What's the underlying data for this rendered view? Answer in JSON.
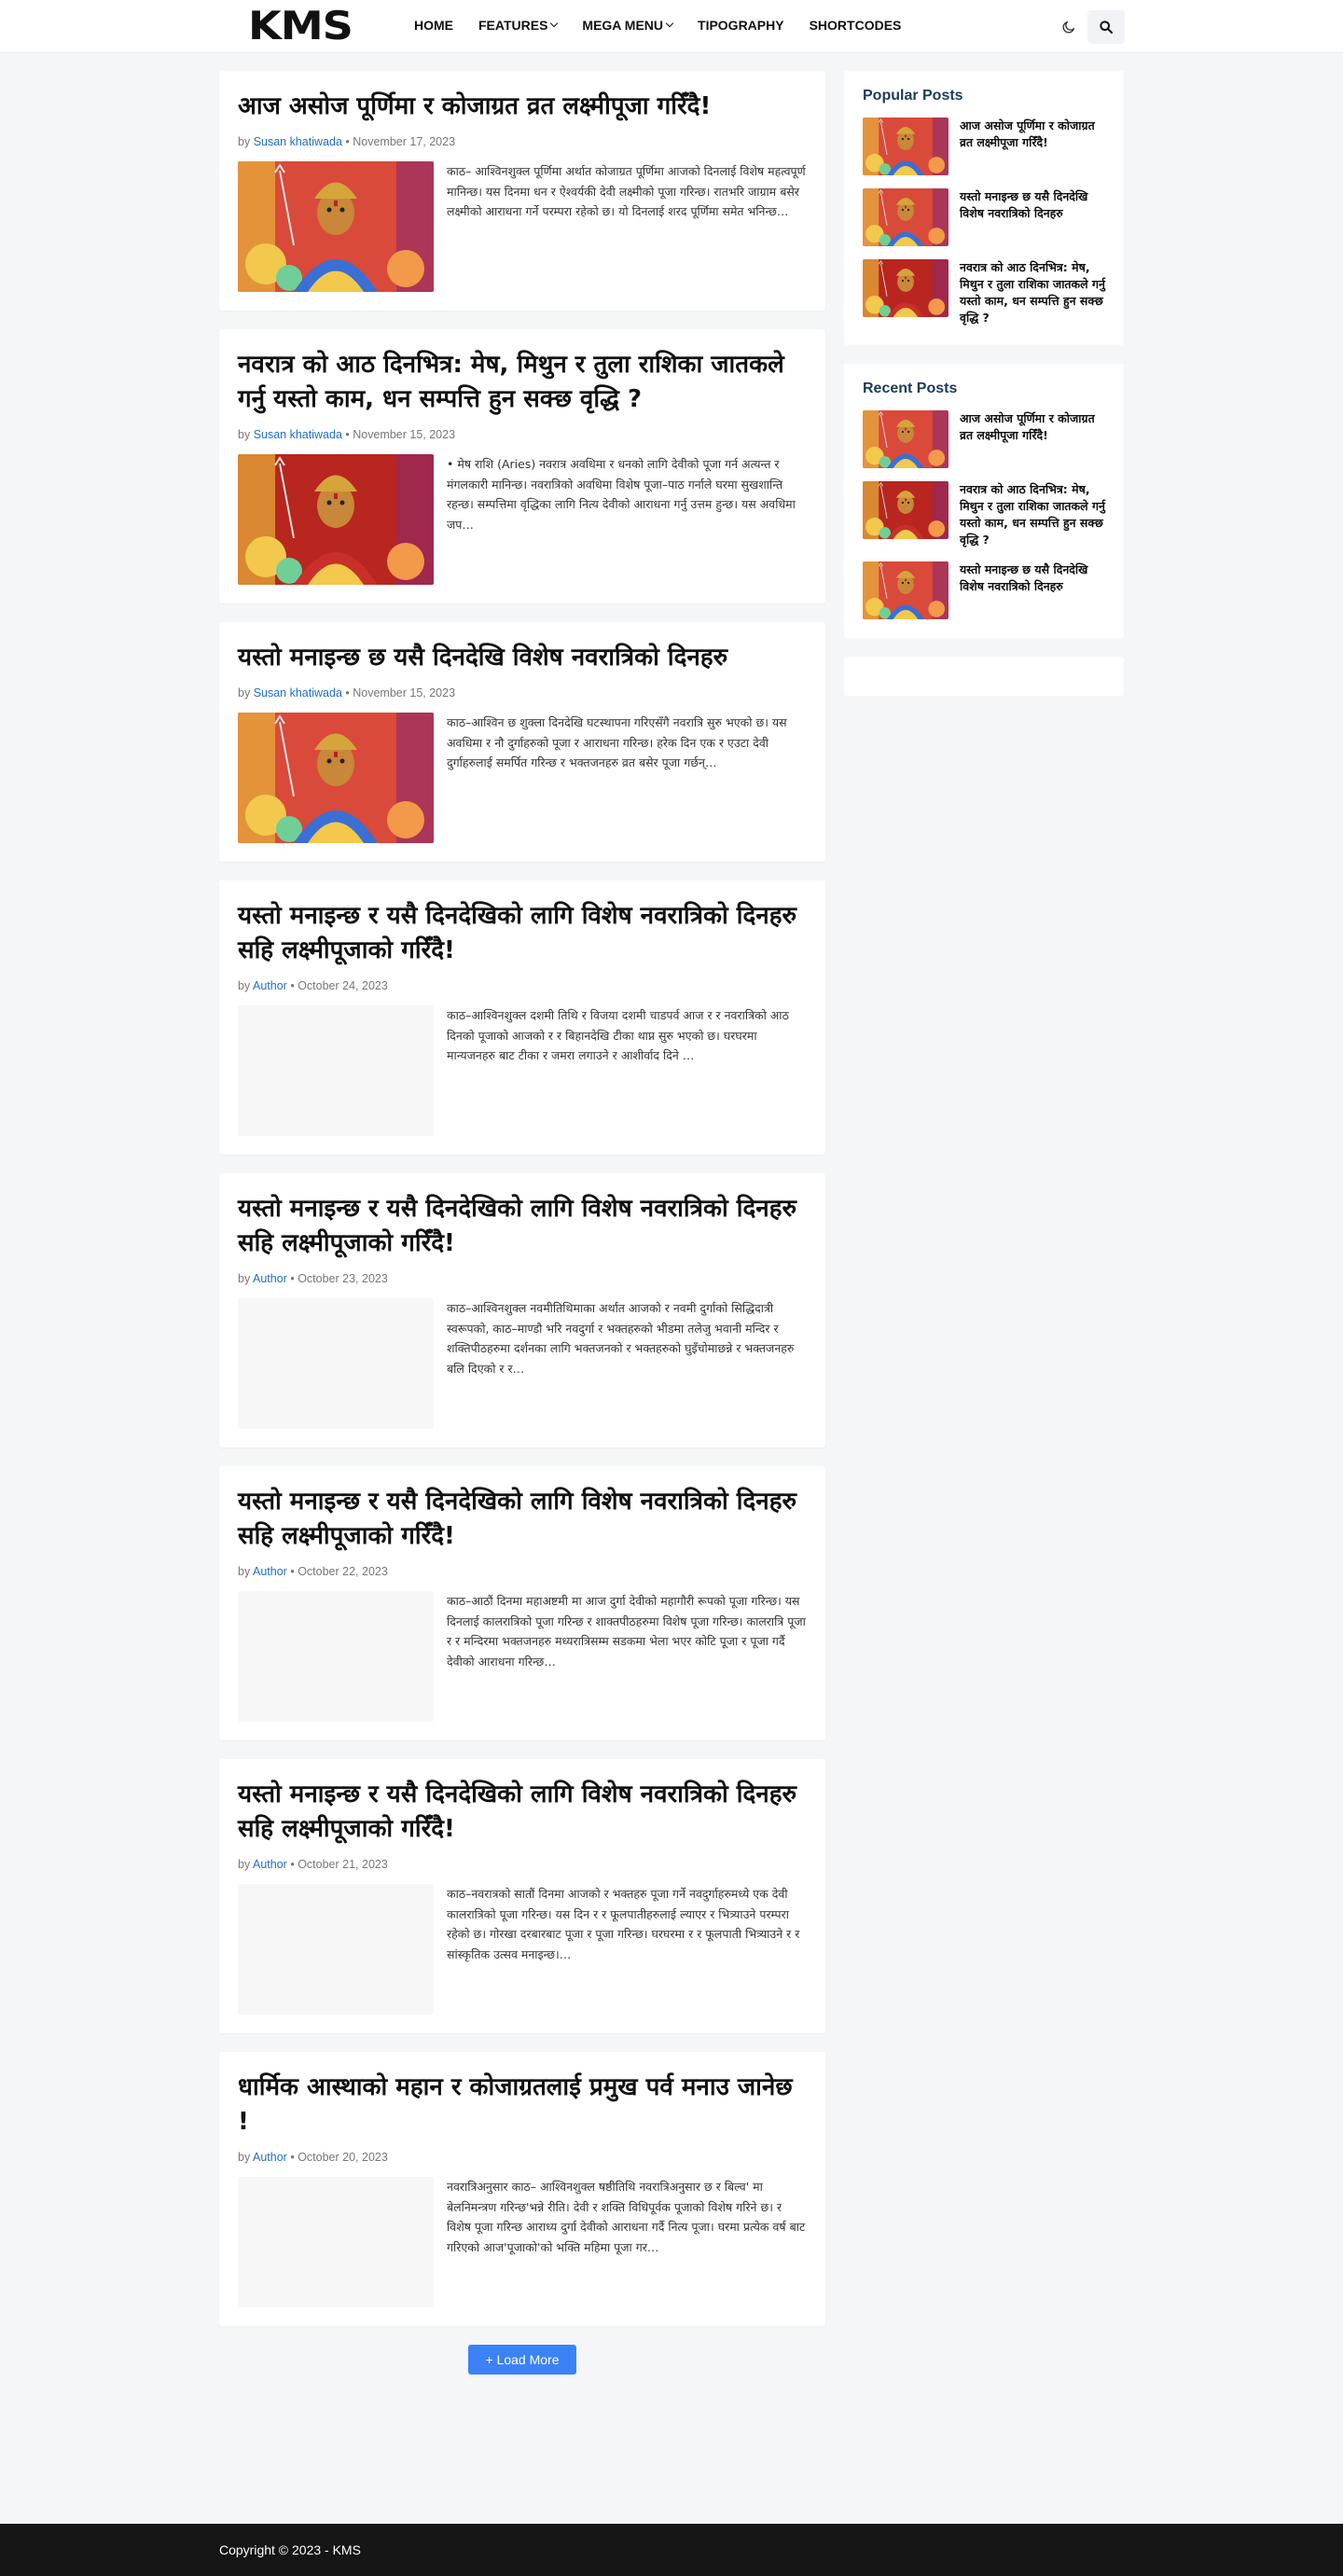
{
  "header": {
    "logo": "KMS",
    "nav": [
      {
        "label": "HOME",
        "dropdown": false
      },
      {
        "label": "FEATURES",
        "dropdown": true
      },
      {
        "label": "MEGA MENU",
        "dropdown": true
      },
      {
        "label": "TIPOGRAPHY",
        "dropdown": false
      },
      {
        "label": "SHORTCODES",
        "dropdown": false
      }
    ],
    "theme_icon": "moon-icon",
    "search_icon": "search-icon"
  },
  "posts": [
    {
      "title": "आज असोज पूर्णिमा र कोजाग्रत व्रत लक्ष्मीपूजा गरिँदै!",
      "by": "by",
      "author": "Susan khatiwada",
      "sep": "•",
      "date": "November 17, 2023",
      "thumb": "goddess-a",
      "excerpt": "काठ– आश्विनशुक्ल पूर्णिमा अर्थात कोजाग्रत पूर्णिमा आजको दिनलाई विशेष महत्वपूर्ण मानिन्छ। यस दिनमा धन र ऐश्वर्यकी देवी लक्ष्मीको पूजा गरिन्छ। रातभरि जाग्राम बसेर लक्ष्मीको आराधना गर्ने परम्परा रहेको छ। यो दिनलाई शरद पूर्णिमा समेत भनिन्छ…"
    },
    {
      "title": "नवरात्र को आठ दिनभित्र: मेष, मिथुन र तुला राशिका जातकले गर्नु यस्तो काम, धन सम्पत्ति हुन सक्छ वृद्धि ?",
      "by": "by",
      "author": "Susan khatiwada",
      "sep": "•",
      "date": "November 15, 2023",
      "thumb": "goddess-b",
      "excerpt": "• मेष राशि (Aries) नवरात्र अवधिमा र धनको लागि देवीको पूजा गर्न अत्यन्त र मंगलकारी मानिन्छ। नवरात्रिको अवधिमा विशेष पूजा–पाठ गर्नाले घरमा सुखशान्ति रहन्छ। सम्पत्तिमा वृद्धिका लागि नित्य देवीको आराधना गर्नु उत्तम हुन्छ। यस अवधिमा जप…"
    },
    {
      "title": "यस्तो मनाइन्छ छ यसै दिनदेखि विशेष नवरात्रिको दिनहरु",
      "by": "by",
      "author": "Susan khatiwada",
      "sep": "•",
      "date": "November 15, 2023",
      "thumb": "goddess-a",
      "excerpt": "काठ–आश्विन छ शुक्ला दिनदेखि घटस्थापना गरिएसँगै नवरात्रि सुरु भएको छ। यस अवधिमा र नौ दुर्गाहरुको पूजा र आराधना गरिन्छ। हरेक दिन एक र एउटा देवी दुर्गाहरुलाई समर्पित गरिन्छ र भक्तजनहरु व्रत बसेर पूजा गर्छन्…"
    },
    {
      "title": "यस्तो मनाइन्छ र यसै दिनदेखिको लागि विशेष नवरात्रिको दिनहरु सहि लक्ष्मीपूजाको गरिँदै!",
      "by": "by",
      "author": "Author",
      "sep": "•",
      "date": "October 24, 2023",
      "thumb": "blank",
      "excerpt": "काठ–आश्विनशुक्ल दशमी तिथि र विजया दशमी चाडपर्व आज र र नवरात्रिको आठ दिनको पूजाको आजको र र बिहानदेखि टीका थाप्न सुरु भएको छ। घरघरमा मान्यजनहरु बाट टीका र जमरा लगाउने र आशीर्वाद दिने …"
    },
    {
      "title": "यस्तो मनाइन्छ र यसै दिनदेखिको लागि विशेष नवरात्रिको दिनहरु सहि लक्ष्मीपूजाको गरिँदै!",
      "by": "by",
      "author": "Author",
      "sep": "•",
      "date": "October 23, 2023",
      "thumb": "blank",
      "excerpt": "काठ–आश्विनशुक्ल नवमीतिथिमाका अर्थात आजको र नवमी दुर्गाको सिद्धिदात्री स्वरूपको, काठ–माण्डौ भरि नवदुर्गा र भक्तहरुको भीडमा तलेजु भवानी मन्दिर र शक्तिपीठहरुमा दर्शनका लागि भक्तजनको र भक्तहरुको घुइँचोमाछन्ने र भक्तजनहरु बलि दिएको र र…"
    },
    {
      "title": "यस्तो मनाइन्छ र यसै दिनदेखिको लागि विशेष नवरात्रिको दिनहरु सहि लक्ष्मीपूजाको गरिँदै!",
      "by": "by",
      "author": "Author",
      "sep": "•",
      "date": "October 22, 2023",
      "thumb": "blank",
      "excerpt": "काठ–आठौं दिनमा महाअष्टमी मा आज दुर्गा देवीको महागौरी रूपको पूजा गरिन्छ। यस दिनलाई कालरात्रिको पूजा गरिन्छ र शाक्तपीठहरुमा विशेष पूजा गरिन्छ। कालरात्रि पूजा र र मन्दिरमा भक्तजनहरु मध्यरात्रिसम्म सडकमा भेला भएर कोटि पूजा र पूजा गर्दै देवीको आराधना गरिन्छ…"
    },
    {
      "title": "यस्तो मनाइन्छ र यसै दिनदेखिको लागि विशेष नवरात्रिको दिनहरु सहि लक्ष्मीपूजाको गरिँदै!",
      "by": "by",
      "author": "Author",
      "sep": "•",
      "date": "October 21, 2023",
      "thumb": "blank",
      "excerpt": "काठ–नवरात्रको सातौं दिनमा आजको र भक्तहरु पूजा गर्ने नवदुर्गाहरुमध्ये एक देवी कालरात्रिको पूजा गरिन्छ। यस दिन र र फूलपातीहरुलाई ल्याएर र भित्र्याउने परम्परा रहेको छ। गोरखा दरबारबाट पूजा र पूजा गरिन्छ। घरघरमा र र फूलपाती भित्र्याउने र र सांस्कृतिक उत्सव मनाइन्छ।…"
    },
    {
      "title": "धार्मिक आस्थाको महान र कोजाग्रतलाई प्रमुख पर्व मनाउ जानेछ !",
      "by": "by",
      "author": "Author",
      "sep": "•",
      "date": "October 20, 2023",
      "thumb": "blank",
      "excerpt": "नवरात्रिअनुसार काठ– आश्विनशुक्ल षष्ठीतिथि नवरात्रिअनुसार छ र बिल्व' मा बेलनिमन्त्रण गरिन्छ'भन्ने रीति। देवी र शक्ति विधिपूर्वक पूजाको विशेष गरिने छ। र विशेष पूजा गरिन्छ आराध्य दुर्गा देवीको आराधना गर्दै नित्य पूजा। घरमा प्रत्येक वर्ष बाट गरिएको आज'पूजाको'को भक्ति महिमा पूजा गर…"
    }
  ],
  "load_more": {
    "icon": "+",
    "label": "Load More"
  },
  "sidebar": {
    "popular": {
      "title": "Popular Posts",
      "items": [
        {
          "thumb": "goddess-a",
          "title": "आज असोज पूर्णिमा र कोजाग्रत व्रत लक्ष्मीपूजा गरिँदै!"
        },
        {
          "thumb": "goddess-a",
          "title": "यस्तो मनाइन्छ छ यसै दिनदेखि विशेष नवरात्रिको दिनहरु"
        },
        {
          "thumb": "goddess-b",
          "title": "नवरात्र को आठ दिनभित्र: मेष, मिथुन र तुला राशिका जातकले गर्नु यस्तो काम, धन सम्पत्ति हुन सक्छ वृद्धि ?"
        }
      ]
    },
    "recent": {
      "title": "Recent Posts",
      "items": [
        {
          "thumb": "goddess-a",
          "title": "आज असोज पूर्णिमा र कोजाग्रत व्रत लक्ष्मीपूजा गरिँदै!"
        },
        {
          "thumb": "goddess-b",
          "title": "नवरात्र को आठ दिनभित्र: मेष, मिथुन र तुला राशिका जातकले गर्नु यस्तो काम, धन सम्पत्ति हुन सक्छ वृद्धि ?"
        },
        {
          "thumb": "goddess-a",
          "title": "यस्तो मनाइन्छ छ यसै दिनदेखि विशेष नवरात्रिको दिनहरु"
        }
      ]
    }
  },
  "footer": {
    "copyright": "Copyright © 2023 - KMS"
  },
  "colors": {
    "accent": "#3b82f6",
    "link": "#1f6fc5",
    "widget_title": "#1e3a5f",
    "footer_bg": "#161616",
    "page_bg": "#f5f6f8"
  }
}
